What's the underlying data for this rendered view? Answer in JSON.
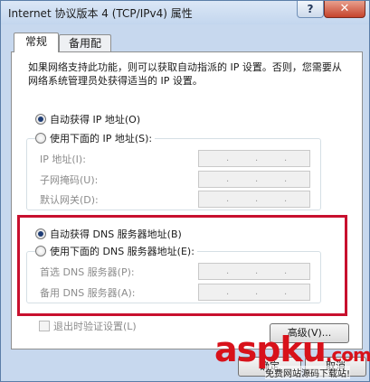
{
  "window": {
    "title": "Internet 协议版本 4 (TCP/IPv4) 属性",
    "help_label": "?",
    "close_label": "✕"
  },
  "tabs": [
    {
      "label": "常规",
      "active": true
    },
    {
      "label": "备用配置",
      "active": false
    }
  ],
  "description": "如果网络支持此功能，则可以获取自动指派的 IP 设置。否则，您需要从网络系统管理员处获得适当的 IP 设置。",
  "ip_section": {
    "auto_label": "自动获得 IP 地址(O)",
    "auto_checked": true,
    "manual_label": "使用下面的 IP 地址(S):",
    "manual_checked": false,
    "fields": [
      {
        "label": "IP 地址(I):"
      },
      {
        "label": "子网掩码(U):"
      },
      {
        "label": "默认网关(D):"
      }
    ]
  },
  "dns_section": {
    "auto_label": "自动获得 DNS 服务器地址(B)",
    "auto_checked": true,
    "manual_label": "使用下面的 DNS 服务器地址(E):",
    "manual_checked": false,
    "fields": [
      {
        "label": "首选 DNS 服务器(P):"
      },
      {
        "label": "备用 DNS 服务器(A):"
      }
    ]
  },
  "validate_label": "退出时验证设置(L)",
  "advanced_label": "高级(V)...",
  "ok_label": "确定",
  "cancel_label": "取消",
  "ip_separator": ".",
  "watermark": {
    "logo": "aspku",
    "suffix": ".com",
    "subtitle": "免费网站源码下载站!"
  },
  "colors": {
    "highlight_frame": "#c8102e",
    "watermark": "#d8121b"
  }
}
